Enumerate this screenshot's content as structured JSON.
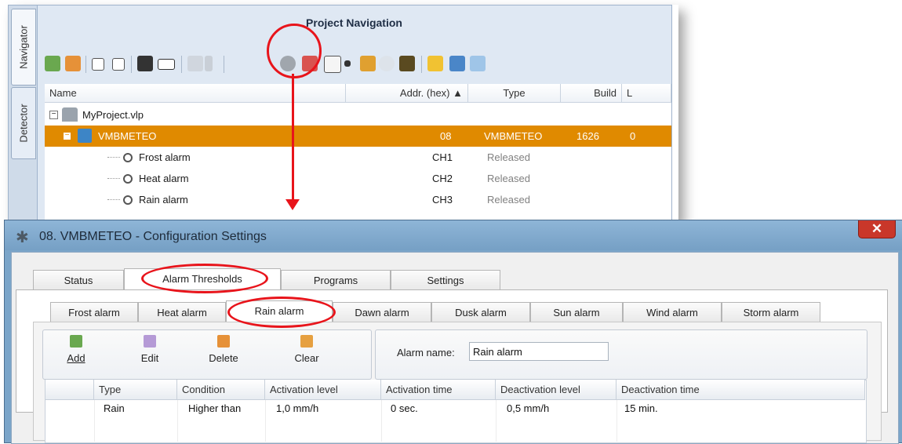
{
  "navigator": {
    "side_tabs": [
      "Navigator",
      "Detector"
    ],
    "title": "Project Navigation",
    "toolbar_icons": [
      "add-module-icon",
      "add-module-alt-icon",
      "expand-all-icon",
      "collapse-all-icon",
      "binoculars-icon",
      "rename-icon",
      "wand-icon",
      "settings-gear-icon",
      "record-icon",
      "firmware-icon",
      "broom-icon",
      "play-icon",
      "bridge-icon",
      "note-icon",
      "list-icon",
      "edit-doc-icon"
    ],
    "columns": [
      "Name",
      "Addr. (hex) ▲",
      "Type",
      "Build",
      "L"
    ],
    "rows": [
      {
        "name": "MyProject.vlp",
        "addr": "",
        "type": "",
        "build": "",
        "l": ""
      },
      {
        "name": "VMBMETEO",
        "addr": "08",
        "type": "VMBMETEO",
        "build": "1626",
        "l": "0"
      },
      {
        "name": "Frost alarm",
        "addr": "CH1",
        "type": "Released",
        "build": "",
        "l": ""
      },
      {
        "name": "Heat alarm",
        "addr": "CH2",
        "type": "Released",
        "build": "",
        "l": ""
      },
      {
        "name": "Rain alarm",
        "addr": "CH3",
        "type": "Released",
        "build": "",
        "l": ""
      }
    ],
    "selected_row_color": "#e08a00"
  },
  "dialog": {
    "title": "08. VMBMETEO - Configuration Settings",
    "close_label": "✕",
    "main_tabs": [
      "Status",
      "Alarm Thresholds",
      "Programs",
      "Settings"
    ],
    "alarm_tabs": [
      "Frost alarm",
      "Heat alarm",
      "Rain alarm",
      "Dawn alarm",
      "Dusk alarm",
      "Sun alarm",
      "Wind alarm",
      "Storm alarm"
    ],
    "actions": {
      "add": "Add",
      "edit": "Edit",
      "delete": "Delete",
      "clear": "Clear"
    },
    "alarm_name_label": "Alarm name:",
    "alarm_name_value": "Rain alarm",
    "grid_columns": [
      "Type",
      "Condition",
      "Activation level",
      "Activation time",
      "Deactivation level",
      "Deactivation time"
    ],
    "grid_rows": [
      {
        "type": "Rain",
        "condition": "Higher than",
        "activation_level": "1,0 mm/h",
        "activation_time": "0 sec.",
        "deactivation_level": "0,5 mm/h",
        "deactivation_time": "15 min."
      }
    ]
  },
  "annotation_color": "#e8141b"
}
